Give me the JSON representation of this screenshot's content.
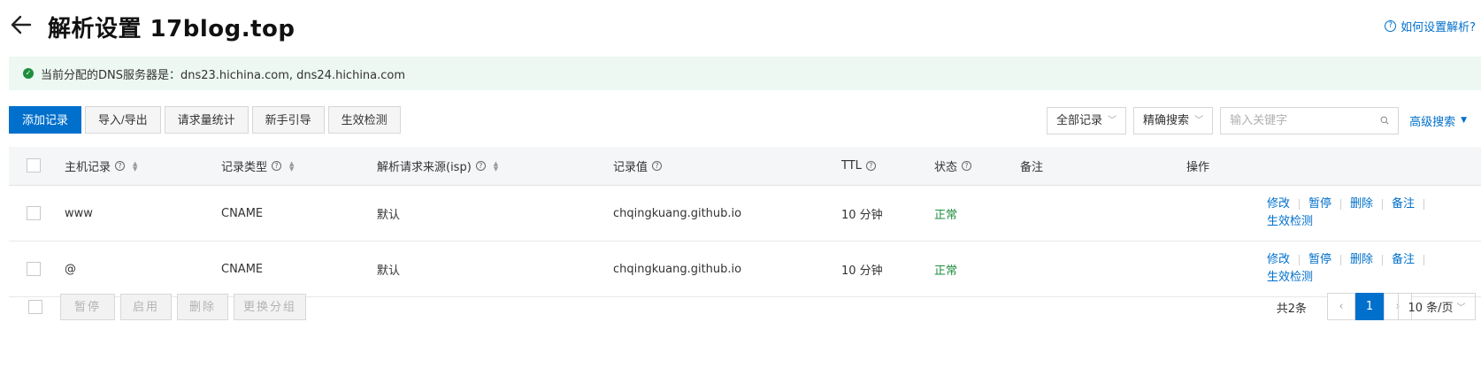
{
  "header": {
    "title": "解析设置 17blog.top",
    "help_link": "如何设置解析?"
  },
  "notice": {
    "text": "当前分配的DNS服务器是：dns23.hichina.com, dns24.hichina.com"
  },
  "toolbar": {
    "add": "添加记录",
    "import_export": "导入/导出",
    "stats": "请求量统计",
    "guide": "新手引导",
    "check": "生效检测"
  },
  "filters": {
    "record_filter": "全部记录",
    "search_mode": "精确搜索",
    "search_placeholder": "输入关键字",
    "advanced": "高级搜索"
  },
  "table": {
    "headers": {
      "host": "主机记录",
      "type": "记录类型",
      "isp": "解析请求来源(isp)",
      "value": "记录值",
      "ttl": "TTL",
      "status": "状态",
      "remark": "备注",
      "actions": "操作"
    },
    "rows": [
      {
        "host": "www",
        "type": "CNAME",
        "isp": "默认",
        "value": "chqingkuang.github.io",
        "ttl": "10 分钟",
        "status": "正常",
        "remark": ""
      },
      {
        "host": "@",
        "type": "CNAME",
        "isp": "默认",
        "value": "chqingkuang.github.io",
        "ttl": "10 分钟",
        "status": "正常",
        "remark": ""
      }
    ],
    "actions": {
      "edit": "修改",
      "pause": "暂停",
      "delete": "删除",
      "remark": "备注",
      "check": "生效检测"
    }
  },
  "footer": {
    "pause": "暂停",
    "enable": "启用",
    "delete": "删除",
    "regroup": "更换分组",
    "total": "共2条",
    "page": "1",
    "page_size": "10 条/页"
  },
  "colors": {
    "primary": "#0070cc",
    "success": "#1e8e3e",
    "notice_bg": "#ecf8f1"
  }
}
